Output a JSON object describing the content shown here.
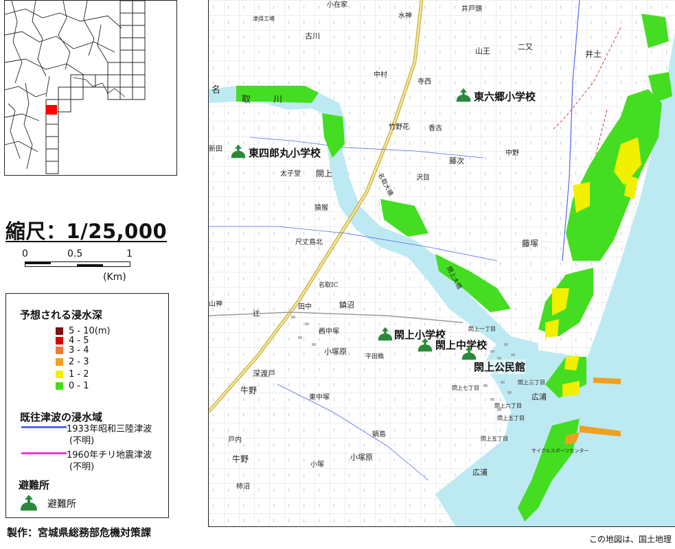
{
  "index_map": {
    "highlight_color": "#ff0000"
  },
  "scale": {
    "title": "縮尺：1/25,000",
    "ticks": [
      "0",
      "0.5",
      "1"
    ],
    "unit": "(Km)"
  },
  "legend": {
    "depth_title": "予想される浸水深",
    "depth_items": [
      {
        "label": "5 - 10(m)",
        "color": "#7a1010"
      },
      {
        "label": "4 - 5",
        "color": "#d40000"
      },
      {
        "label": "3 - 4",
        "color": "#f07840"
      },
      {
        "label": "2 - 3",
        "color": "#f0a020"
      },
      {
        "label": "1 - 2",
        "color": "#f0f000"
      },
      {
        "label": "0 - 1",
        "color": "#44dd22"
      }
    ],
    "past_title": "既往津波の浸水域",
    "past_items": [
      {
        "label": "1933年昭和三陸津波",
        "note": "(不明)",
        "color": "#5566ee"
      },
      {
        "label": "1960年チリ地震津波",
        "note": "(不明)",
        "color": "#ff33cc"
      }
    ],
    "shelter_title": "避難所",
    "shelter_label": "避難所",
    "shelter_color": "#2a8a3a"
  },
  "maker": "製作：宮城県総務部危機対策課",
  "credit": "この地図は、国土地理",
  "map": {
    "schools": [
      "東六郷小学校",
      "東四郎丸小学校",
      "閖上小学校",
      "閖上中学校",
      "閖上公民館"
    ],
    "places": [
      "小在家",
      "井戸頭",
      "古川",
      "津得工場",
      "山王",
      "二又",
      "井土",
      "名",
      "取",
      "川",
      "中村",
      "寺西",
      "竹野花",
      "香古",
      "藤次",
      "沢目",
      "中野",
      "太子堂",
      "閖上",
      "猿猴",
      "尺丈島北",
      "藤塚",
      "新田",
      "名取IC",
      "田中",
      "鎮沼",
      "西中塚",
      "小塚原",
      "平田橋",
      "深渡戸",
      "牛野",
      "東中塚",
      "鍋島",
      "小塚原",
      "小塚",
      "戸内",
      "牛野",
      "柿沼",
      "広浦",
      "広浦",
      "閖上七丁目",
      "閖上六丁目",
      "閖上五丁目",
      "閖上三丁目",
      "閖上一丁目",
      "閖上五丁目",
      "サイクルスポーツセンター",
      "名取大橋",
      "閖上大橋",
      "水神",
      "辻",
      "山神"
    ]
  }
}
